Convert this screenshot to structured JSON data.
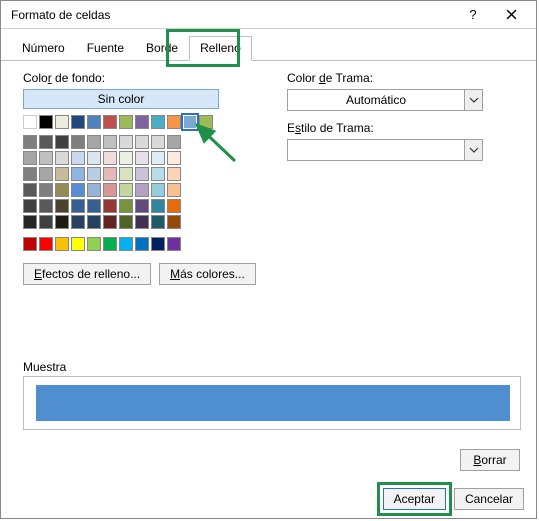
{
  "window": {
    "title": "Formato de celdas"
  },
  "tabs": {
    "numero": "Número",
    "fuente": "Fuente",
    "borde": "Borde",
    "relleno": "Relleno"
  },
  "labels": {
    "color_fondo": "Color de fondo:",
    "sin_color": "Sin color",
    "efectos": "Efectos de relleno...",
    "mas_colores": "Más colores...",
    "color_trama": "Color de Trama:",
    "automatico": "Automático",
    "estilo_trama": "Estilo de Trama:",
    "muestra": "Muestra",
    "borrar": "Borrar",
    "aceptar": "Aceptar",
    "cancelar": "Cancelar"
  },
  "palette": {
    "row1": [
      "#ffffff",
      "#000000",
      "#eeece1",
      "#1f497d",
      "#4f81bd",
      "#c0504d",
      "#9bbb59",
      "#8064a2",
      "#4bacc6",
      "#f79646",
      "#7ba7d5",
      "#9bbb59"
    ],
    "theme": [
      [
        "#7f7f7f",
        "#595959",
        "#404040",
        "#7f7f7f",
        "#a6a6a6",
        "#bfbfbf",
        "#d9d9d9",
        "#d9d9d9",
        "#d9d9d9",
        "#a6a6a6"
      ],
      [
        "#a6a6a6",
        "#bfbfbf",
        "#d9d9d9",
        "#c6d9f1",
        "#dce6f2",
        "#f2dcdb",
        "#ebf1de",
        "#e6e0ec",
        "#dbeef4",
        "#fdeada"
      ],
      [
        "#808080",
        "#a6a6a6",
        "#c4bd97",
        "#8eb4e3",
        "#b9cde5",
        "#e6b9b8",
        "#d7e4bd",
        "#ccc1da",
        "#b7dee8",
        "#fcd5b5"
      ],
      [
        "#595959",
        "#7f7f7f",
        "#948a54",
        "#558ed5",
        "#95b3d7",
        "#d99694",
        "#c3d69b",
        "#b3a2c7",
        "#93cddd",
        "#fac090"
      ],
      [
        "#404040",
        "#595959",
        "#4a452a",
        "#376092",
        "#376092",
        "#953735",
        "#77933c",
        "#604a7b",
        "#31859c",
        "#e46c0a"
      ],
      [
        "#262626",
        "#404040",
        "#1e1c11",
        "#254061",
        "#254061",
        "#632523",
        "#4f6228",
        "#403152",
        "#215968",
        "#984807"
      ]
    ],
    "standard": [
      "#c00000",
      "#ff0000",
      "#ffc000",
      "#ffff00",
      "#92d050",
      "#00b050",
      "#00b0f0",
      "#0070c0",
      "#002060",
      "#7030a0"
    ],
    "selected_index": 10
  },
  "sample_color": "#4f8fcf"
}
